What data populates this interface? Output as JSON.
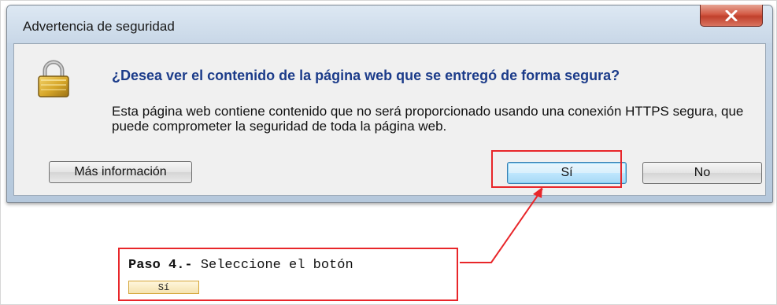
{
  "dialog": {
    "title": "Advertencia de seguridad",
    "heading": "¿Desea ver el contenido de la página web que se entregó de forma segura?",
    "body": "Esta página web contiene contenido que no será proporcionado usando una conexión HTTPS segura, que puede comprometer la seguridad de toda la página web.",
    "buttons": {
      "more_info": "Más información",
      "yes": "Sí",
      "no": "No"
    },
    "icons": {
      "close": "close-icon",
      "lock": "lock-icon"
    }
  },
  "callout": {
    "step": "Paso 4.-",
    "instruction": " Seleccione el botón",
    "button_label": "Sí"
  },
  "colors": {
    "highlight": "#e8262a",
    "heading": "#1c3c8a",
    "close_button": "#c0402c"
  }
}
